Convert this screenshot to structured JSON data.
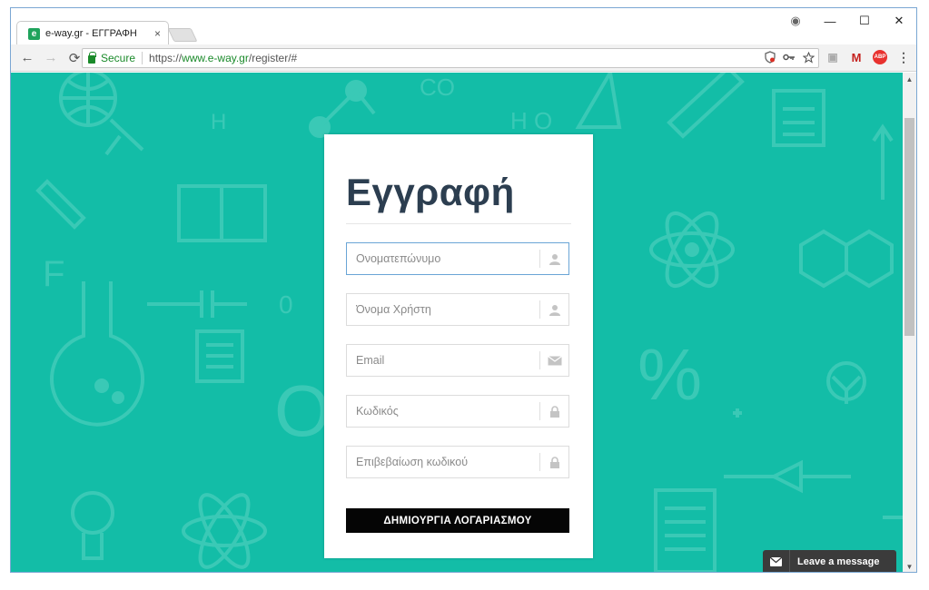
{
  "browser": {
    "tab": {
      "favicon": "e",
      "title": "e-way.gr - ΕΓΓΡΑΦΗ",
      "close": "×"
    },
    "window_controls": {
      "account": "◉",
      "minimize": "—",
      "maximize": "☐",
      "close": "✕"
    },
    "nav": {
      "back": "←",
      "forward": "→",
      "reload": "⟳"
    },
    "omnibox": {
      "secure_label": "Secure",
      "url_scheme": "https://",
      "url_host": "www.e-way.gr",
      "url_path": "/register/#"
    },
    "extensions": {
      "abp": "ABP",
      "gmail": "M",
      "menu": "⋮"
    }
  },
  "page": {
    "background_color": "#13bda7",
    "title": "Εγγραφή",
    "fields": [
      {
        "placeholder": "Ονοματεπώνυμο",
        "icon": "user-icon"
      },
      {
        "placeholder": "Όνομα Χρήστη",
        "icon": "user-icon"
      },
      {
        "placeholder": "Email",
        "icon": "envelope-icon"
      },
      {
        "placeholder": "Κωδικός",
        "icon": "lock-icon"
      },
      {
        "placeholder": "Επιβεβαίωση κωδικού",
        "icon": "lock-icon"
      }
    ],
    "submit_label": "ΔΗΜΙΟΥΡΓΙΑ ΛΟΓΑΡΙΑΣΜΟΥ"
  },
  "chat_widget": {
    "label": "Leave a message"
  }
}
